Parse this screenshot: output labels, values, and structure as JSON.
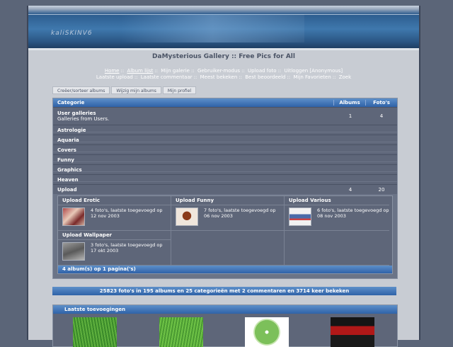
{
  "header": {
    "logo": "kaliSKINV6"
  },
  "site_title": "DaMysterious Gallery :: Free Pics for All",
  "nav_line1": [
    "Home",
    "Album lijst",
    "Mijn galerie",
    "Gebruiker-modus",
    "Upload foto",
    "Uitloggen [Anonymous]"
  ],
  "nav_line2": [
    "Laatste upload",
    "Laatste commentaar",
    "Meest bekeken",
    "Best beoordeeld",
    "Mijn Favorieten",
    "Zoek"
  ],
  "tabs": [
    "Creëer/sorteer albums",
    "Wijzig mijn albums",
    "Mijn profiel"
  ],
  "table": {
    "headers": {
      "category": "Categorie",
      "albums": "Albums",
      "photos": "Foto's"
    },
    "user_galleries": {
      "name": "User galleries",
      "desc": "Galleries from Users.",
      "albums": "1",
      "photos": "4"
    },
    "categories": [
      "Astrologie",
      "Aquaria",
      "Covers",
      "Funny",
      "Graphics",
      "Heaven"
    ],
    "upload": {
      "name": "Upload",
      "albums": "4",
      "photos": "20"
    }
  },
  "albums": [
    {
      "title": "Upload Erotic",
      "info": "4 foto's, laatste toegevoegd op 12 nov 2003"
    },
    {
      "title": "Upload Funny",
      "info": "7 foto's, laatste toegevoegd op 06 nov 2003"
    },
    {
      "title": "Upload Various",
      "info": "6 foto's, laatste toegevoegd op 08 nov 2003"
    },
    {
      "title": "Upload Wallpaper",
      "info": "3 foto's, laatste toegevoegd op 17 okt 2003"
    }
  ],
  "albums_footer": "4 album(s) op 1 pagina('s)",
  "stats": "25823 foto's in 195 albums en 25 categorieën met 2 commentaren en 3714 keer bekeken",
  "recent": {
    "title": "Laatste toevoegingen"
  },
  "colors": {
    "header_blue": "#2f62a8",
    "row_bg": "#5e6679",
    "page_bg": "#5b6578"
  }
}
